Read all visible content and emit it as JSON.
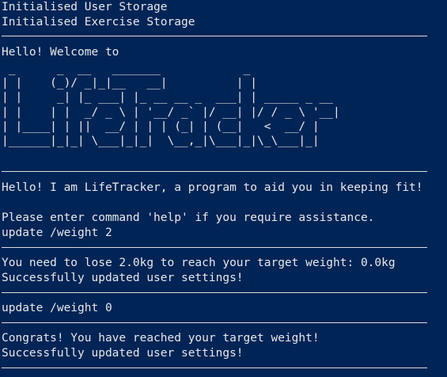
{
  "startup": {
    "line1": "Initialised User Storage",
    "line2": "Initialised Exercise Storage"
  },
  "welcome": {
    "greeting": "Hello! Welcome to",
    "logo_art": " _      _  __   _______            _\n| |    (_)/ _|_|__   __|          | |\n| |     _| |_ ___| |_ __ __ _  ___| | _____ _ __\n| |    | |  _/ _ \\ | '__/ _` |/ __| |/ / _ \\ '__|\n| |____| | ||  __/ | | | (_| | (__|   <  __/ |\n|______|_|_| \\___|_|_|  \\__,_|\\___|_|\\_\\___|_|",
    "logo_text": "LifeTracker"
  },
  "intro": {
    "line1": "Hello! I am LifeTracker, a program to aid you in keeping fit!",
    "line2": "Please enter command 'help' if you require assistance."
  },
  "session": [
    {
      "command": "update /weight 2",
      "responses": [
        "You need to lose 2.0kg to reach your target weight: 0.0kg",
        "Successfully updated user settings!"
      ]
    },
    {
      "command": "update /weight 0",
      "responses": [
        "Congrats! You have reached your target weight!",
        "Successfully updated user settings!"
      ]
    }
  ]
}
